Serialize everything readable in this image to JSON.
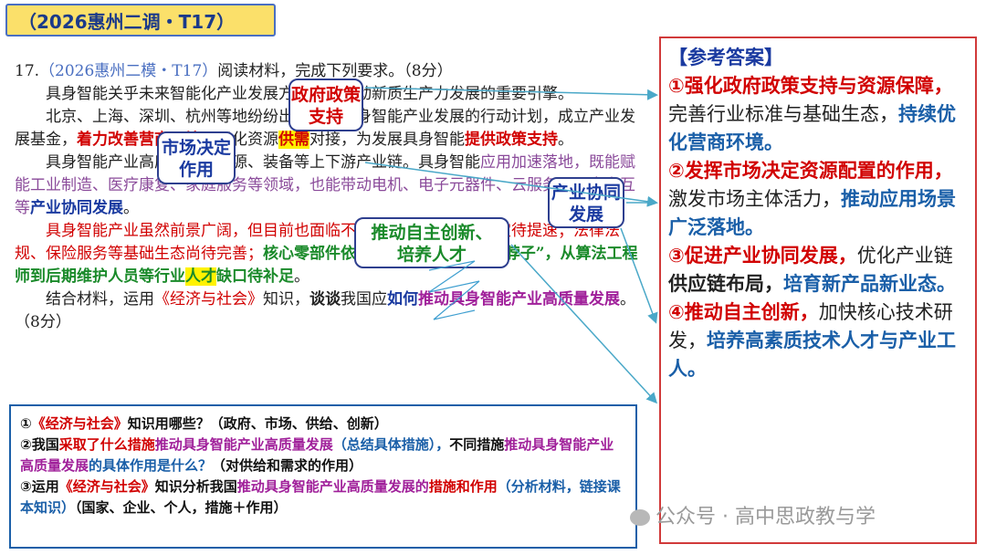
{
  "header": {
    "title": "（2026惠州二调・T17）"
  },
  "question": {
    "number": "17.",
    "source": "（2026惠州二模・T17）",
    "instruction": "阅读材料，完成下列要求。（8分）",
    "p1": "具身智能关乎未来智能化产业发展方向，是推动新质生产力发展的重要引擎。",
    "p2a": "北京、上海、深圳、杭州等地纷纷出台有关具身智能产业发展的行动计划，成立产业发展基金，",
    "p2b": "着力改善营商环境",
    "p2c": "，强化资源",
    "p2d": "供需",
    "p2e": "对接，为发展具身智能",
    "p2f": "提供政策支持",
    "p2g": "。",
    "p3a": "具身智能产业高度依赖新能源、装备等上下游产业链。具身智能",
    "p3b": "应用加速落地，既能赋能工业制造、医疗康复、家庭服务等领域，也能带动电机、电子元器件、云服务、语音交互等",
    "p3c": "产业协同发展",
    "p3d": "。",
    "p4a": "具身智能产业虽然前景广阔，但目前也面临不少挑战：行业标准制定待提速；法律法规、保险服务等基础生态尚待完善；",
    "p4b": "核心零部件依赖进口，核心技术“卡脖子”，从算法工程师到后期维护人员等行业",
    "p4c": "人才",
    "p4d": "缺口待补足",
    "p4e": "。",
    "p5a": "结合材料，运用",
    "p5b": "《经济与社会》",
    "p5c": "知识，",
    "p5d": "谈谈",
    "p5e": "我国应",
    "p5f": "如何",
    "p5g": "推动具身智能产业高质量发展",
    "p5h": "。（8分）"
  },
  "callouts": {
    "gov": "政府政策支持",
    "market": "市场决定作用",
    "industry": "产业协同发展",
    "innovation": "推动自主创新、培养人才"
  },
  "answer": {
    "title": "【参考答案】",
    "a1_red": "①强化政府政策支持与资源保障，",
    "a1_plain": "完善行业标准与基础生态，",
    "a1_blue": "持续优化营商环境。",
    "a2_red": "②发挥市场决定资源配置的作用，",
    "a2_plain": "激发市场主体活力，",
    "a2_blue": "推动应用场景广泛落地。",
    "a3_red": "③促进产业协同发展，",
    "a3_plain": "优化产业链",
    "a3_bold": "供应链布局，",
    "a3_blue": "培育新产品新业态。",
    "a4_red": "④推动自主创新，",
    "a4_plain": "加快核心技术研发，",
    "a4_blue": "培养高素质技术人才与产业工人。"
  },
  "tasks": {
    "t1a": "①",
    "t1b": "《经济与社会》",
    "t1c": "知识用哪些？（政府、市场、供给、创新）",
    "t2a": "②我国",
    "t2b": "采取了什么措施",
    "t2c": "推动具身智能产业高质量发展",
    "t2d": "（总结具体措施），",
    "t2e": "不同措施",
    "t2f": "推动具身智能产业高质量发展",
    "t2g": "的具体作用是什么？",
    "t2h": "（对供给和需求的作用）",
    "t3a": "③运用",
    "t3b": "《经济与社会》",
    "t3c": "知识分析我国",
    "t3d": "推动具身智能产业高质量发展的",
    "t3e": "措施和作用",
    "t3f": "（分析材料，链接课本知识）",
    "t3g": "（国家、企业、个人，措施＋作用）"
  },
  "watermark": "公众号 · 高中思政教与学",
  "colors": {
    "accent_red": "#d10000",
    "accent_blue": "#1a3aa0",
    "accent_green": "#1a8a2a",
    "title_bg": "#fbe06a"
  }
}
